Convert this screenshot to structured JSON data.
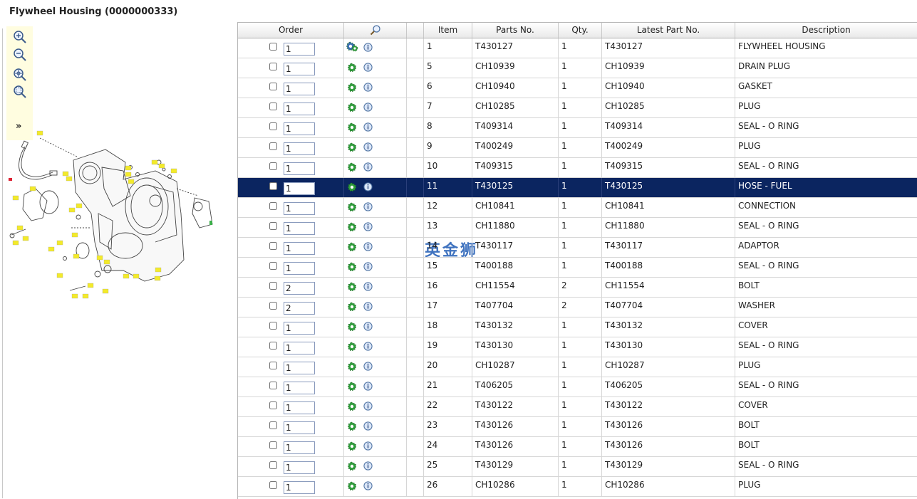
{
  "title": "Flywheel Housing (0000000333)",
  "watermark": "英金狮",
  "accent_colors": {
    "selected_row": "#0b2560",
    "toolbar_bg": "#fffde0",
    "gear_green": "#2e9d3a"
  },
  "toolbar": {
    "icons": [
      "zoom-in-icon",
      "zoom-out-icon",
      "zoom-fit-icon",
      "zoom-window-icon"
    ],
    "expand_label": "»"
  },
  "diagram": {
    "callouts": [
      "13",
      "14",
      "15",
      "12",
      "11",
      "10",
      "9",
      "8",
      "7",
      "6",
      "5",
      "4",
      "3",
      "2",
      "1",
      "16",
      "17",
      "18",
      "19",
      "20",
      "21",
      "22",
      "23",
      "24",
      "25",
      "26",
      "27",
      "28",
      "29",
      "30",
      "31",
      "32",
      "33",
      "34",
      "35",
      "36",
      "37",
      "38",
      "39"
    ]
  },
  "table": {
    "headers": {
      "order": "Order",
      "search_icon": "search-icon",
      "item": "Item",
      "parts_no": "Parts No.",
      "qty": "Qty.",
      "latest_part_no": "Latest Part No.",
      "description": "Description"
    },
    "selected_item": "11",
    "rows": [
      {
        "order": "1",
        "item": "1",
        "parts_no": "T430127",
        "qty": "1",
        "latest_part_no": "T430127",
        "description": "FLYWHEEL HOUSING"
      },
      {
        "order": "1",
        "item": "5",
        "parts_no": "CH10939",
        "qty": "1",
        "latest_part_no": "CH10939",
        "description": "DRAIN PLUG"
      },
      {
        "order": "1",
        "item": "6",
        "parts_no": "CH10940",
        "qty": "1",
        "latest_part_no": "CH10940",
        "description": "GASKET"
      },
      {
        "order": "1",
        "item": "7",
        "parts_no": "CH10285",
        "qty": "1",
        "latest_part_no": "CH10285",
        "description": "PLUG"
      },
      {
        "order": "1",
        "item": "8",
        "parts_no": "T409314",
        "qty": "1",
        "latest_part_no": "T409314",
        "description": "SEAL - O RING"
      },
      {
        "order": "1",
        "item": "9",
        "parts_no": "T400249",
        "qty": "1",
        "latest_part_no": "T400249",
        "description": "PLUG"
      },
      {
        "order": "1",
        "item": "10",
        "parts_no": "T409315",
        "qty": "1",
        "latest_part_no": "T409315",
        "description": "SEAL - O RING"
      },
      {
        "order": "1",
        "item": "11",
        "parts_no": "T430125",
        "qty": "1",
        "latest_part_no": "T430125",
        "description": "HOSE - FUEL"
      },
      {
        "order": "1",
        "item": "12",
        "parts_no": "CH10841",
        "qty": "1",
        "latest_part_no": "CH10841",
        "description": "CONNECTION"
      },
      {
        "order": "1",
        "item": "13",
        "parts_no": "CH11880",
        "qty": "1",
        "latest_part_no": "CH11880",
        "description": "SEAL - O RING"
      },
      {
        "order": "1",
        "item": "14",
        "parts_no": "T430117",
        "qty": "1",
        "latest_part_no": "T430117",
        "description": "ADAPTOR"
      },
      {
        "order": "1",
        "item": "15",
        "parts_no": "T400188",
        "qty": "1",
        "latest_part_no": "T400188",
        "description": "SEAL - O RING"
      },
      {
        "order": "2",
        "item": "16",
        "parts_no": "CH11554",
        "qty": "2",
        "latest_part_no": "CH11554",
        "description": "BOLT"
      },
      {
        "order": "2",
        "item": "17",
        "parts_no": "T407704",
        "qty": "2",
        "latest_part_no": "T407704",
        "description": "WASHER"
      },
      {
        "order": "1",
        "item": "18",
        "parts_no": "T430132",
        "qty": "1",
        "latest_part_no": "T430132",
        "description": "COVER"
      },
      {
        "order": "1",
        "item": "19",
        "parts_no": "T430130",
        "qty": "1",
        "latest_part_no": "T430130",
        "description": "SEAL - O RING"
      },
      {
        "order": "1",
        "item": "20",
        "parts_no": "CH10287",
        "qty": "1",
        "latest_part_no": "CH10287",
        "description": "PLUG"
      },
      {
        "order": "1",
        "item": "21",
        "parts_no": "T406205",
        "qty": "1",
        "latest_part_no": "T406205",
        "description": "SEAL - O RING"
      },
      {
        "order": "1",
        "item": "22",
        "parts_no": "T430122",
        "qty": "1",
        "latest_part_no": "T430122",
        "description": "COVER"
      },
      {
        "order": "1",
        "item": "23",
        "parts_no": "T430126",
        "qty": "1",
        "latest_part_no": "T430126",
        "description": "BOLT"
      },
      {
        "order": "1",
        "item": "24",
        "parts_no": "T430126",
        "qty": "1",
        "latest_part_no": "T430126",
        "description": "BOLT"
      },
      {
        "order": "1",
        "item": "25",
        "parts_no": "T430129",
        "qty": "1",
        "latest_part_no": "T430129",
        "description": "SEAL - O RING"
      },
      {
        "order": "1",
        "item": "26",
        "parts_no": "CH10286",
        "qty": "1",
        "latest_part_no": "CH10286",
        "description": "PLUG"
      }
    ]
  }
}
